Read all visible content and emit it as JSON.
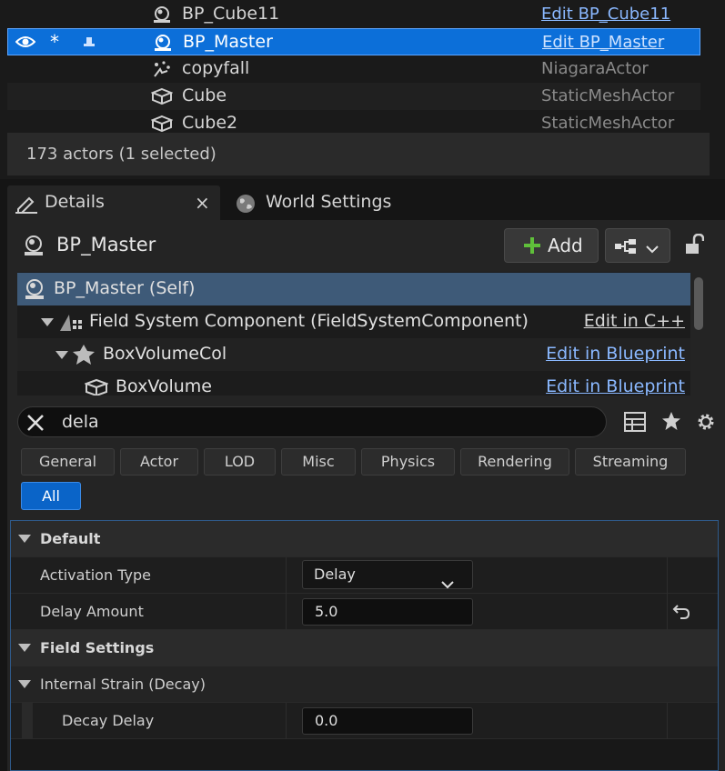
{
  "outliner": {
    "rows": [
      {
        "name": "BP_Cube11",
        "type": "Edit BP_Cube11"
      },
      {
        "name": "BP_Master",
        "type": "Edit BP_Master"
      },
      {
        "name": "copyfall",
        "type": "NiagaraActor"
      },
      {
        "name": "Cube",
        "type": "StaticMeshActor"
      },
      {
        "name": "Cube2",
        "type": "StaticMeshActor"
      }
    ],
    "status": "173 actors (1 selected)"
  },
  "tabs": {
    "details": "Details",
    "world_settings": "World Settings"
  },
  "details": {
    "actor_name": "BP_Master",
    "add_label": "Add",
    "components": [
      {
        "name": "BP_Master (Self)",
        "action": ""
      },
      {
        "name": "Field System Component (FieldSystemComponent)",
        "action": "Edit in C++"
      },
      {
        "name": "BoxVolumeCol",
        "action": "Edit in Blueprint"
      },
      {
        "name": "BoxVolume",
        "action": "Edit in Blueprint"
      }
    ],
    "search_value": "dela",
    "filters": [
      "General",
      "Actor",
      "LOD",
      "Misc",
      "Physics",
      "Rendering",
      "Streaming",
      "All"
    ],
    "properties": {
      "default_category": "Default",
      "activation_type_label": "Activation Type",
      "activation_type_value": "Delay",
      "delay_amount_label": "Delay Amount",
      "delay_amount_value": "5.0",
      "field_settings_category": "Field Settings",
      "internal_strain_label": "Internal Strain (Decay)",
      "decay_delay_label": "Decay Delay",
      "decay_delay_value": "0.0"
    }
  },
  "colors": {
    "selection": "#0c6fd9",
    "link": "#8ab8ff",
    "add_plus": "#5fbf3a"
  }
}
